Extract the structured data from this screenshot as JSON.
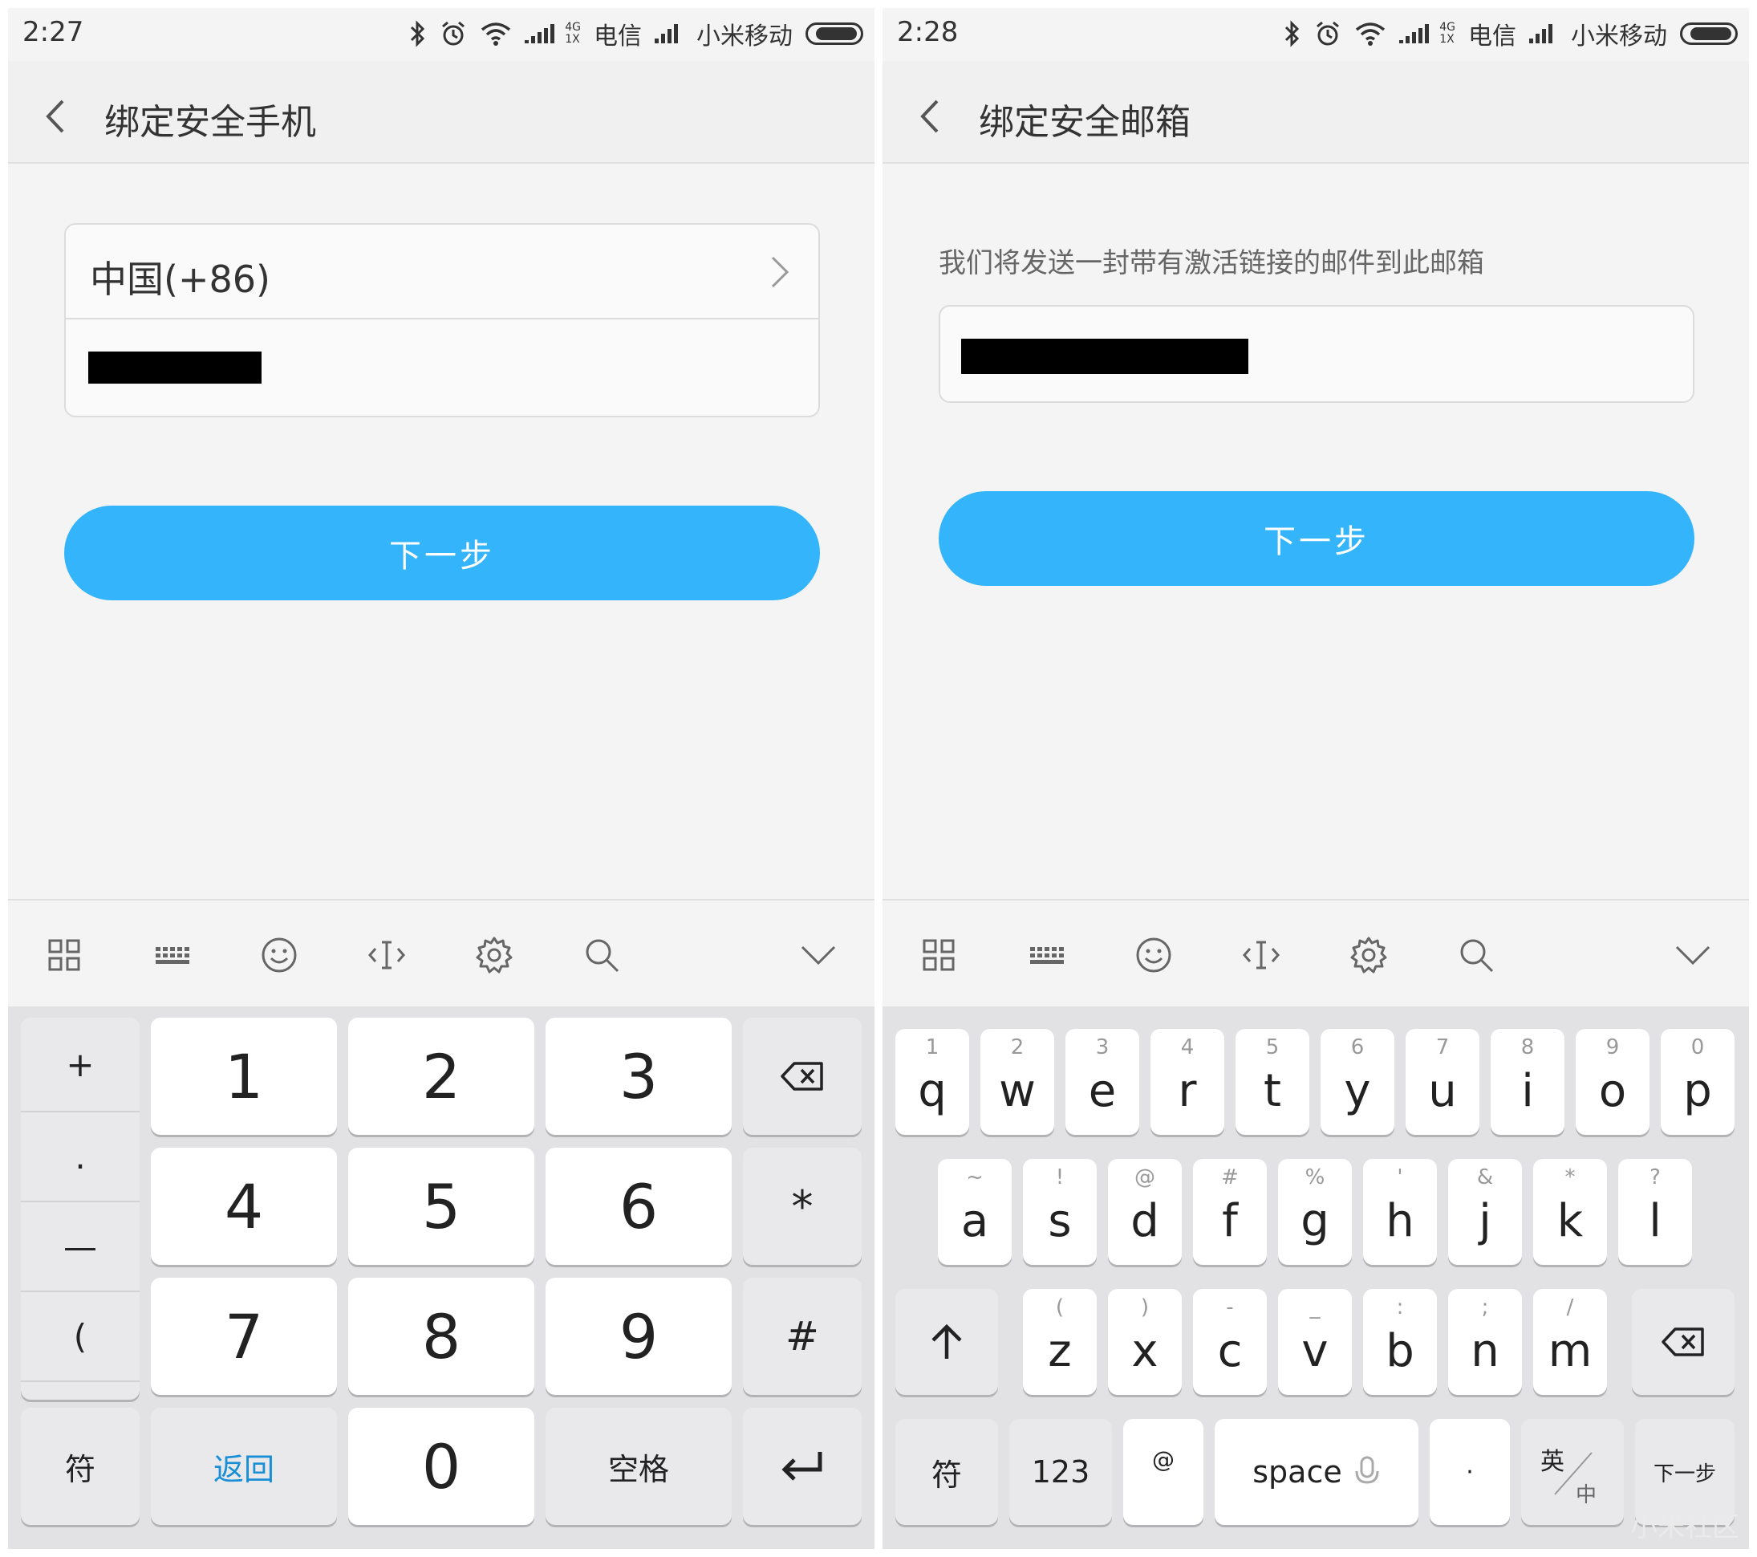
{
  "left": {
    "status": {
      "time": "2:27",
      "network_small_top": "4G",
      "network_small_bottom": "1X",
      "carrier1": "电信",
      "carrier2": "小米移动"
    },
    "header": {
      "title": "绑定安全手机"
    },
    "country_code": "中国(+86)",
    "next_button": "下一步",
    "keyboard": {
      "symbols": [
        "+",
        ".",
        "—",
        "("
      ],
      "digits": [
        "1",
        "2",
        "3",
        "4",
        "5",
        "6",
        "7",
        "8",
        "9"
      ],
      "side": [
        "*",
        "#"
      ],
      "bottom": {
        "fu": "符",
        "back": "返回",
        "zero": "0",
        "space": "空格"
      },
      "back_color": "#1a8fd6"
    }
  },
  "right": {
    "status": {
      "time": "2:28",
      "network_small_top": "4G",
      "network_small_bottom": "1X",
      "carrier1": "电信",
      "carrier2": "小米移动"
    },
    "header": {
      "title": "绑定安全邮箱"
    },
    "hint": "我们将发送一封带有激活链接的邮件到此邮箱",
    "next_button": "下一步",
    "keyboard": {
      "row1": [
        {
          "k": "q",
          "s": "1"
        },
        {
          "k": "w",
          "s": "2"
        },
        {
          "k": "e",
          "s": "3"
        },
        {
          "k": "r",
          "s": "4"
        },
        {
          "k": "t",
          "s": "5"
        },
        {
          "k": "y",
          "s": "6"
        },
        {
          "k": "u",
          "s": "7"
        },
        {
          "k": "i",
          "s": "8"
        },
        {
          "k": "o",
          "s": "9"
        },
        {
          "k": "p",
          "s": "0"
        }
      ],
      "row2": [
        {
          "k": "a",
          "s": "~"
        },
        {
          "k": "s",
          "s": "!"
        },
        {
          "k": "d",
          "s": "@"
        },
        {
          "k": "f",
          "s": "#"
        },
        {
          "k": "g",
          "s": "%"
        },
        {
          "k": "h",
          "s": "'"
        },
        {
          "k": "j",
          "s": "&"
        },
        {
          "k": "k",
          "s": "*"
        },
        {
          "k": "l",
          "s": "?"
        }
      ],
      "row3": [
        {
          "k": "z",
          "s": "("
        },
        {
          "k": "x",
          "s": ")"
        },
        {
          "k": "c",
          "s": "-"
        },
        {
          "k": "v",
          "s": "_"
        },
        {
          "k": "b",
          "s": ":"
        },
        {
          "k": "n",
          "s": ";"
        },
        {
          "k": "m",
          "s": "/"
        }
      ],
      "bottom": {
        "fu": "符",
        "num": "123",
        "at": "@",
        "space": "space",
        "dot": "·",
        "lang_top": "英",
        "lang_bottom": "中",
        "next": "下一步"
      }
    }
  },
  "watermark": "小米社区",
  "colors": {
    "accent": "#34b4fb",
    "background": "#f4f4f4",
    "keyboard_bg": "#e2e2e4"
  }
}
